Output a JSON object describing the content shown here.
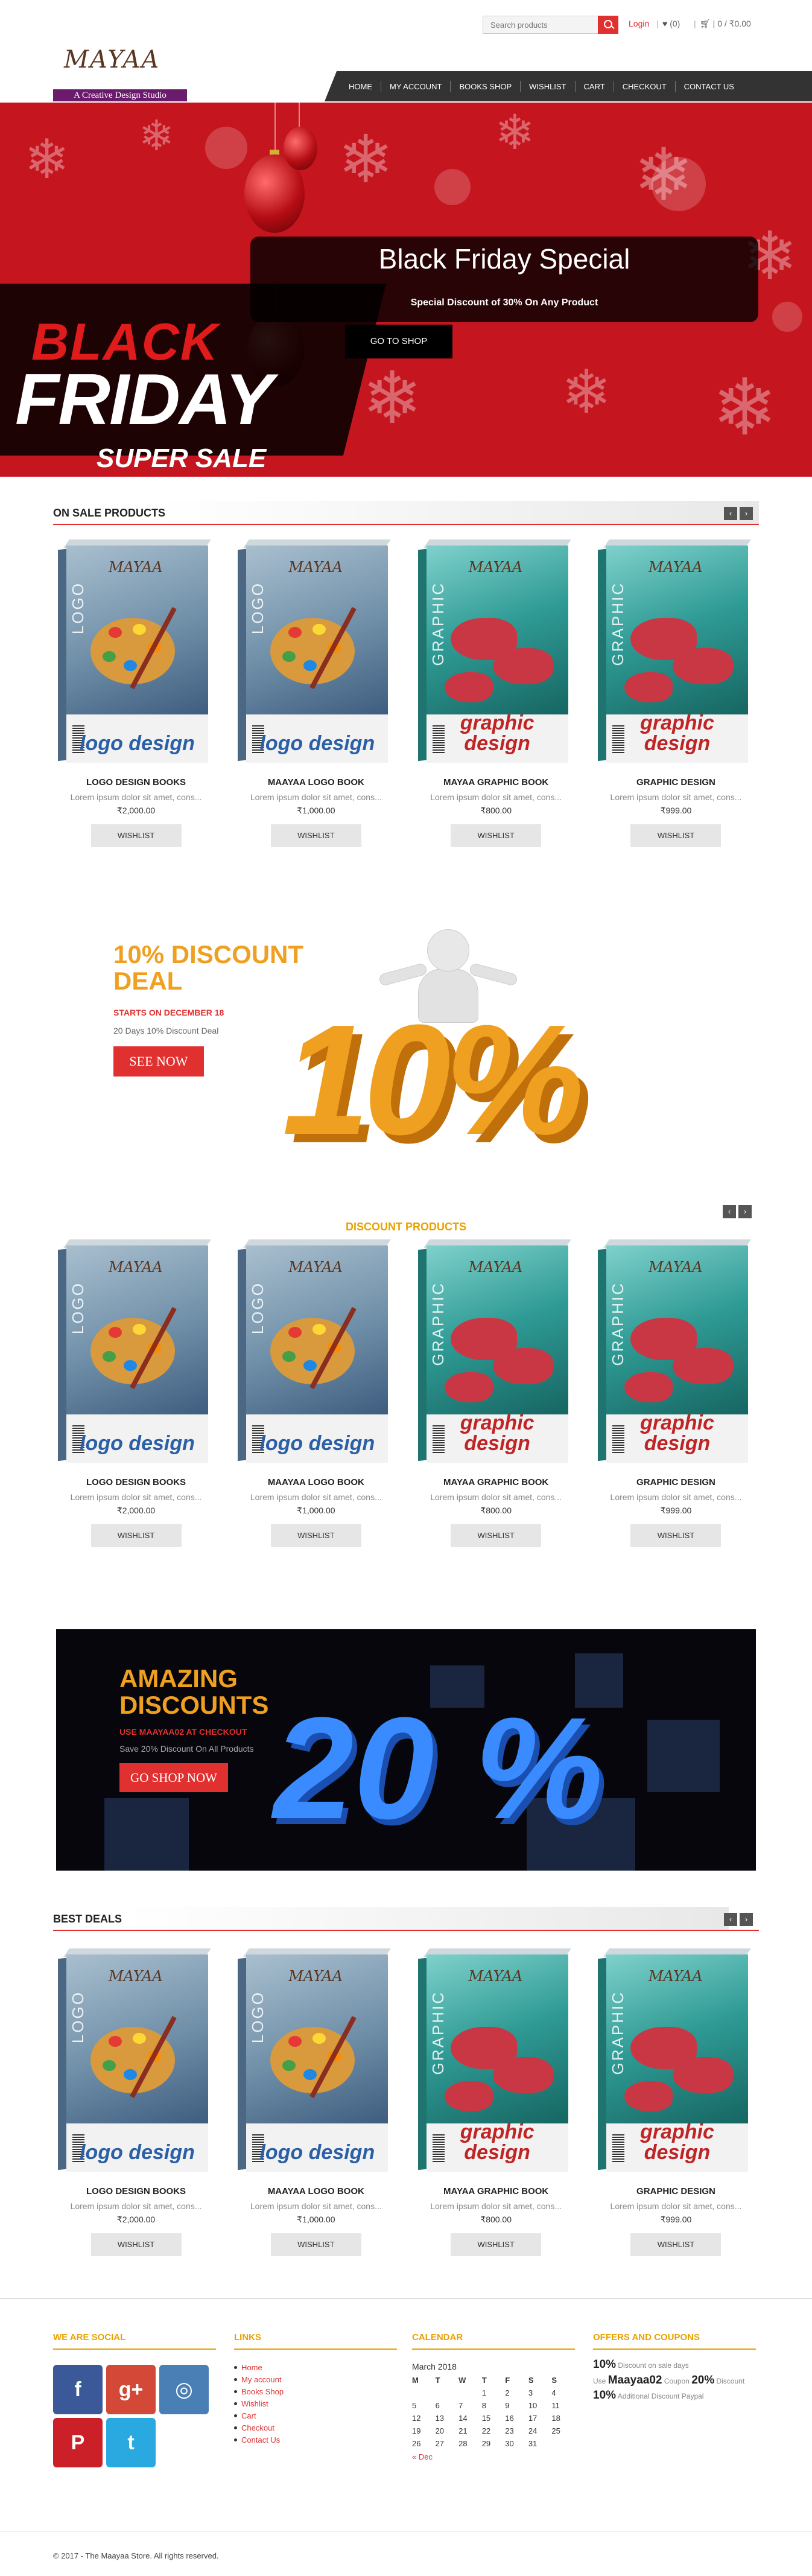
{
  "header": {
    "search_placeholder": "Search products",
    "login_label": "Login",
    "wishlist_count": "(0)",
    "cart_summary": "| 0 / ₹0.00",
    "logo_script": "MAYAA",
    "logo_tagline": "A Creative Design Studio",
    "nav": [
      "HOME",
      "MY ACCOUNT",
      "BOOKS SHOP",
      "WISHLIST",
      "CART",
      "CHECKOUT",
      "CONTACT US"
    ]
  },
  "hero": {
    "art_black": "BLACK",
    "art_friday": "FRIDAY",
    "art_super": "SUPER SALE",
    "title": "Black Friday Special",
    "subtitle": "Special Discount of 30% On Any Product",
    "button": "GO TO SHOP"
  },
  "on_sale": {
    "title": "ON SALE PRODUCTS",
    "products": [
      {
        "name": "LOGO DESIGN BOOKS",
        "desc": "Lorem ipsum dolor sit amet, cons...",
        "price": "₹2,000.00",
        "art": "logo",
        "wishlist": "WISHLIST"
      },
      {
        "name": "MAAYAA LOGO BOOK",
        "desc": "Lorem ipsum dolor sit amet, cons...",
        "price": "₹1,000.00",
        "art": "logo",
        "wishlist": "WISHLIST"
      },
      {
        "name": "MAYAA GRAPHIC BOOK",
        "desc": "Lorem ipsum dolor sit amet, cons...",
        "price": "₹800.00",
        "art": "graphic",
        "wishlist": "WISHLIST"
      },
      {
        "name": "GRAPHIC DESIGN",
        "desc": "Lorem ipsum dolor sit amet, cons...",
        "price": "₹999.00",
        "art": "graphic",
        "wishlist": "WISHLIST"
      }
    ]
  },
  "promo_discount": {
    "title_line1": "10% DISCOUNT",
    "title_line2": "DEAL",
    "subtitle": "STARTS ON DECEMBER 18",
    "small": "20 Days 10% Discount Deal",
    "button": "SEE NOW",
    "art_text": "10%",
    "title_color": "#f0a020"
  },
  "discount_products": {
    "title": "DISCOUNT PRODUCTS",
    "products": [
      {
        "name": "LOGO DESIGN BOOKS",
        "desc": "Lorem ipsum dolor sit amet, cons...",
        "price": "₹2,000.00",
        "art": "logo",
        "wishlist": "WISHLIST"
      },
      {
        "name": "MAAYAA LOGO BOOK",
        "desc": "Lorem ipsum dolor sit amet, cons...",
        "price": "₹1,000.00",
        "art": "logo",
        "wishlist": "WISHLIST"
      },
      {
        "name": "MAYAA GRAPHIC BOOK",
        "desc": "Lorem ipsum dolor sit amet, cons...",
        "price": "₹800.00",
        "art": "graphic",
        "wishlist": "WISHLIST"
      },
      {
        "name": "GRAPHIC DESIGN",
        "desc": "Lorem ipsum dolor sit amet, cons...",
        "price": "₹999.00",
        "art": "graphic",
        "wishlist": "WISHLIST"
      }
    ]
  },
  "promo_amazing": {
    "title_line1": "AMAZING",
    "title_line2": "DISCOUNTS",
    "subtitle": "USE MAAYAA02 AT CHECKOUT",
    "small": "Save 20% Discount On All Products",
    "button": "GO SHOP NOW",
    "art_text": "20 %",
    "title_color": "#f0a020"
  },
  "best_deals": {
    "title": "BEST DEALS",
    "products": [
      {
        "name": "LOGO DESIGN BOOKS",
        "desc": "Lorem ipsum dolor sit amet, cons...",
        "price": "₹2,000.00",
        "art": "logo",
        "wishlist": "WISHLIST"
      },
      {
        "name": "MAAYAA LOGO BOOK",
        "desc": "Lorem ipsum dolor sit amet, cons...",
        "price": "₹1,000.00",
        "art": "logo",
        "wishlist": "WISHLIST"
      },
      {
        "name": "MAYAA GRAPHIC BOOK",
        "desc": "Lorem ipsum dolor sit amet, cons...",
        "price": "₹800.00",
        "art": "graphic",
        "wishlist": "WISHLIST"
      },
      {
        "name": "GRAPHIC DESIGN",
        "desc": "Lorem ipsum dolor sit amet, cons...",
        "price": "₹999.00",
        "art": "graphic",
        "wishlist": "WISHLIST"
      }
    ]
  },
  "product_art": {
    "logo_vertical": "LOGO",
    "logo_label": "logo design",
    "graphic_vertical": "GRAPHIC",
    "graphic_label": "graphic design",
    "brand": "MAYAA"
  },
  "footer": {
    "social_title": "WE ARE SOCIAL",
    "social_icons": [
      {
        "name": "facebook-icon",
        "glyph": "f",
        "color": "#3b5998"
      },
      {
        "name": "google-plus-icon",
        "glyph": "g+",
        "color": "#d34836"
      },
      {
        "name": "instagram-icon",
        "glyph": "◎",
        "color": "#4a7fb5"
      },
      {
        "name": "pinterest-icon",
        "glyph": "P",
        "color": "#cb2027"
      },
      {
        "name": "twitter-icon",
        "glyph": "t",
        "color": "#2aa9e0"
      }
    ],
    "links_title": "LINKS",
    "links": [
      "Home",
      "My account",
      "Books Shop",
      "Wishlist",
      "Cart",
      "Checkout",
      "Contact Us"
    ],
    "calendar_title": "CALENDAR",
    "calendar": {
      "month": "March 2018",
      "days": [
        "M",
        "T",
        "W",
        "T",
        "F",
        "S",
        "S"
      ],
      "weeks": [
        [
          "",
          "",
          "",
          "1",
          "2",
          "3",
          "4"
        ],
        [
          "5",
          "6",
          "7",
          "8",
          "9",
          "10",
          "11"
        ],
        [
          "12",
          "13",
          "14",
          "15",
          "16",
          "17",
          "18"
        ],
        [
          "19",
          "20",
          "21",
          "22",
          "23",
          "24",
          "25"
        ],
        [
          "26",
          "27",
          "28",
          "29",
          "30",
          "31",
          ""
        ]
      ],
      "prev": "« Dec"
    },
    "offers_title": "OFFERS AND COUPONS",
    "offers": [
      {
        "big": "10%",
        "text": " Discount on sale days"
      },
      {
        "pre": "Use ",
        "big": "Maayaa02",
        "mid": " Coupon ",
        "big2": "20%",
        "text": " Discount"
      },
      {
        "big": "10%",
        "text": " Additional Discount Paypal"
      }
    ],
    "copyright": "© 2017 - The Maayaa Store. All rights reserved."
  },
  "colors": {
    "accent_red": "#e0302f",
    "accent_orange": "#e8a200",
    "nav_bg": "#333333",
    "hero_bg": "#c5161f"
  }
}
